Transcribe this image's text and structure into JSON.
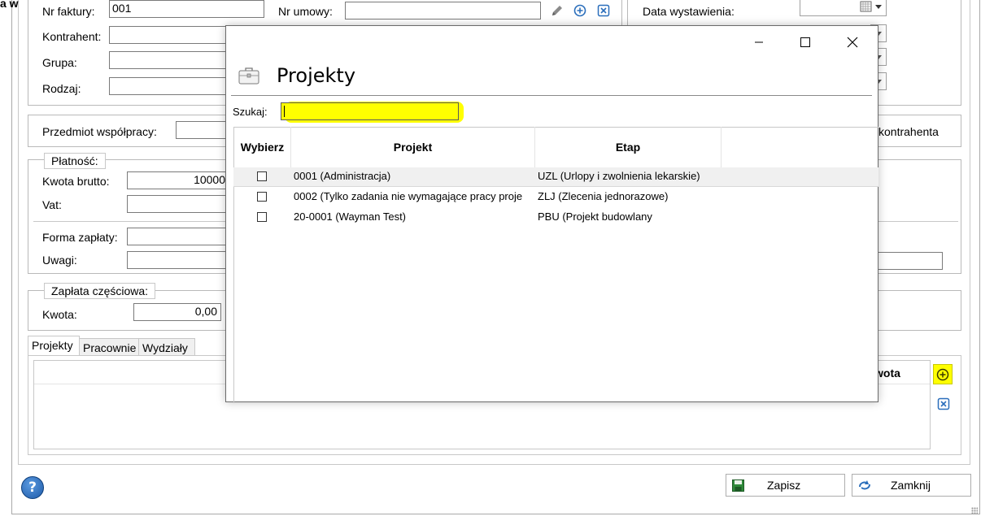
{
  "background_form": {
    "corner_label": "a w",
    "invoice_no_label": "Nr faktury:",
    "invoice_no_value": "001",
    "contract_no_label": "Nr umowy:",
    "issue_date_label": "Data wystawienia:",
    "contractor_label": "Kontrahent:",
    "group_label": "Grupa:",
    "type_label": "Rodzaj:",
    "subject_label": "Przedmiot współpracy:",
    "contractor_right_label": "kontrahenta",
    "payment_legend": "Płatność:",
    "gross_amount_label": "Kwota brutto:",
    "gross_amount_value": "10000",
    "vat_label": "Vat:",
    "payment_form_label": "Forma zapłaty:",
    "notes_label": "Uwagi:",
    "partial_payment_legend": "Zapłata częściowa:",
    "amount_label": "Kwota:",
    "amount_value": "0,00",
    "tabs": [
      "Projekty",
      "Pracownie",
      "Wydziały"
    ],
    "table_right_header": "wota",
    "save_button": "Zapisz",
    "close_button": "Zamknij"
  },
  "modal": {
    "title": "Projekty",
    "search_label": "Szukaj:",
    "search_value": "",
    "columns": [
      "Wybierz",
      "Projekt",
      "Etap"
    ],
    "rows": [
      {
        "project": "0001 (Administracja)",
        "stage": "UZL (Urlopy i zwolnienia lekarskie)",
        "checked": false
      },
      {
        "project": "0002  (Tylko  zadania  nie  wymagające  pracy  proje",
        "stage": "ZLJ (Zlecenia jednorazowe)",
        "checked": false
      },
      {
        "project": "20-0001 (Wayman Test)",
        "stage": "PBU (Projekt budowlany",
        "checked": false
      }
    ]
  },
  "colors": {
    "highlight": "#ffff00",
    "accent_blue": "#2a6ebb",
    "help_blue": "#1e5aa8"
  }
}
